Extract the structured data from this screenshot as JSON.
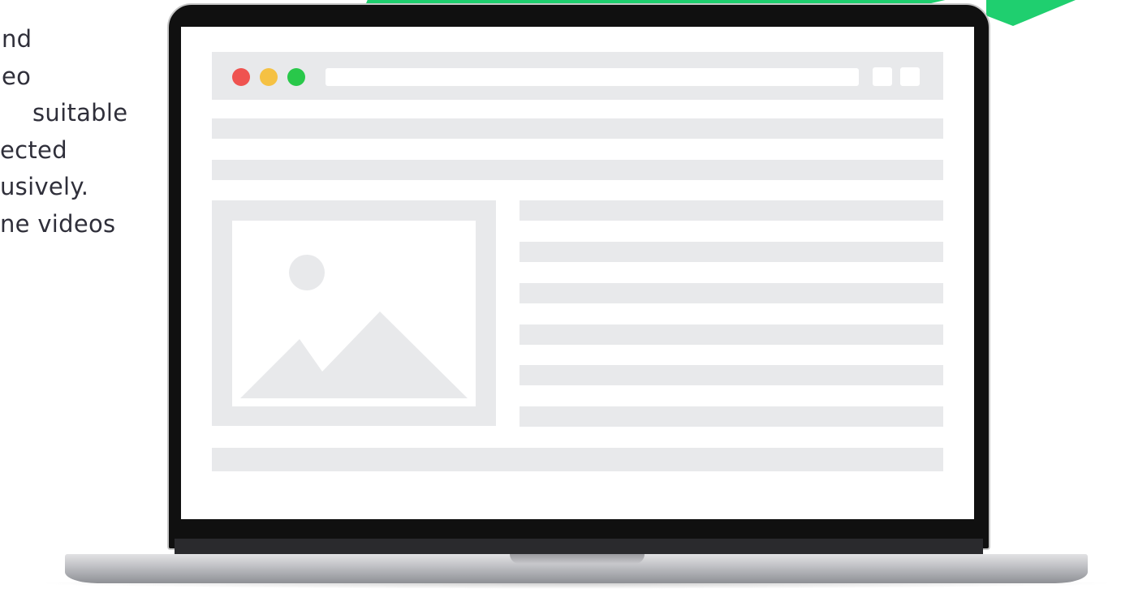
{
  "left_text": {
    "lines": [
      "nd",
      "eo",
      "suitable",
      "ected",
      "usively.",
      "ne videos"
    ]
  },
  "colors": {
    "accent_green": "#1fcf6f",
    "traffic_red": "#ef5350",
    "traffic_yellow": "#f5c143",
    "traffic_green": "#29c84a",
    "placeholder_gray": "#e8e9eb"
  },
  "icons": {
    "image_placeholder": "image-placeholder-icon",
    "close": "close-dot-icon",
    "minimize": "minimize-dot-icon",
    "maximize": "maximize-dot-icon"
  }
}
